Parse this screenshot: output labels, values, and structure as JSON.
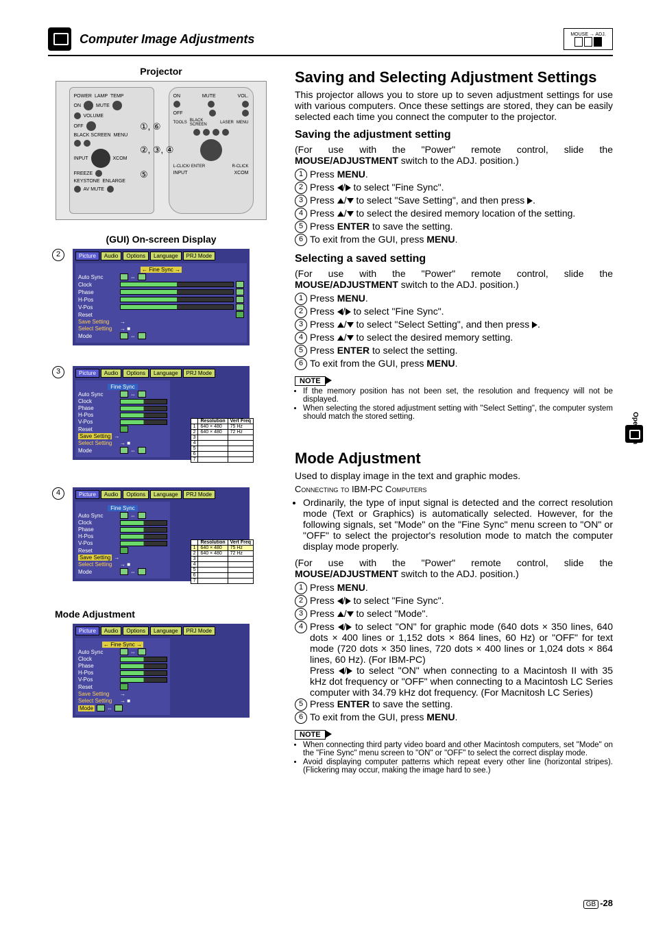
{
  "header": {
    "title": "Computer Image Adjustments",
    "switch_top": "MOUSE",
    "switch_right": "ADJ."
  },
  "left": {
    "projector_label": "Projector",
    "callouts": {
      "a": "①, ⑥",
      "b": "②, ③, ④",
      "c": "⑤"
    },
    "remote": {
      "on_lbl": "ON",
      "mute_lbl": "MUTE",
      "off_lbl": "OFF",
      "black_lbl": "BLACK SCREEN",
      "menu_lbl": "MENU",
      "input_lbl": "INPUT",
      "freeze_lbl": "FREEZE",
      "keystone_lbl": "KEYSTONE",
      "av_lbl": "AV MUTE",
      "vol_lbl": "VOL.",
      "laser_lbl": "LASER",
      "tools_lbl": "TOOLS",
      "enlarge_lbl": "ENLARGE",
      "rc_lbl": "R-CLICK",
      "enter_lbl": "L-CLICK/ ENTER",
      "xcom_lbl": "XCOM"
    },
    "gui_label": "(GUI) On-screen Display",
    "osd_common": {
      "tabs": [
        "Picture",
        "Audio",
        "Options",
        "Language",
        "PRJ Mode"
      ],
      "fine_sync": "Fine Sync",
      "rows": [
        "Auto Sync",
        "Clock",
        "Phase",
        "H-Pos",
        "V-Pos",
        "Reset"
      ],
      "save": "Save Setting",
      "select": "Select Setting",
      "mode": "Mode"
    },
    "subtable": {
      "h1": "Resolution",
      "h2": "Vert Freq",
      "r1c1": "640 × 480",
      "r1c2": "75 Hz",
      "r2c1": "640 × 480",
      "r2c2": "72 Hz"
    },
    "mode_adj_label": "Mode Adjustment"
  },
  "right": {
    "sec1_title": "Saving and Selecting Adjustment Settings",
    "sec1_intro": "This projector allows you to store up to seven adjustment settings for use with various computers. Once these settings are stored, they can be easily selected each time you connect the computer to the projector.",
    "save_sub": "Saving the adjustment setting",
    "slide_note": "(For use with the \"Power\" remote control, slide the ",
    "slide_bold": "MOUSE/ADJUSTMENT",
    "slide_rest": " switch to the ADJ. position.)",
    "save_steps": [
      "Press MENU.",
      "Press ◀/▶ to select \"Fine Sync\".",
      "Press ▲/▼ to select \"Save Setting\", and then press ▶.",
      "Press ▲/▼ to select the desired memory location of the setting.",
      "Press ENTER to save the setting.",
      "To exit from the GUI, press MENU."
    ],
    "select_sub": "Selecting a saved setting",
    "select_steps": [
      "Press MENU.",
      "Press ◀/▶ to select \"Fine Sync\".",
      "Press ▲/▼ to select \"Select Setting\", and then press ▶.",
      "Press ▲/▼ to select the desired memory setting.",
      "Press ENTER to select the setting.",
      "To exit from the GUI, press MENU."
    ],
    "note_label": "NOTE",
    "notes1": [
      "If the memory position has not been set, the resolution and frequency will not be displayed.",
      "When selecting the stored adjustment setting with \"Select Setting\", the computer system should match the stored setting."
    ],
    "sec2_title": "Mode Adjustment",
    "sec2_intro": "Used to display image in the text and graphic modes.",
    "sec2_sc": "Connecting to IBM-PC Computers",
    "sec2_bullet": "Ordinarily, the type of input signal is detected and the correct resolution mode (Text or Graphics) is automatically selected. However, for the following signals, set \"Mode\" on the \"Fine Sync\" menu screen to \"ON\" or \"OFF\" to select the projector's resolution mode to match the computer display mode properly.",
    "mode_steps": [
      "Press MENU.",
      "Press ◀/▶ to select \"Fine Sync\".",
      "Press ▲/▼ to select \"Mode\".",
      "Press ◀/▶ to select \"ON\" for graphic mode (640 dots × 350 lines, 640 dots × 400 lines or 1,152 dots × 864 lines, 60 Hz) or \"OFF\" for text mode (720 dots × 350 lines, 720 dots × 400 lines or 1,024 dots × 864 lines, 60 Hz). (For IBM-PC)\nPress ◀/▶ to select \"ON\" when connecting to a Macintosh II with 35 kHz dot frequency or \"OFF\" when connecting to a Macintosh LC Series computer with 34.79 kHz dot frequency. (For Macnitosh LC Series)",
      "Press ENTER to save the setting.",
      "To exit from the GUI, press MENU."
    ],
    "notes2": [
      "When connecting third party video board and other Macintosh computers, set \"Mode\" on the \"Fine Sync\" menu screen to \"ON\" or \"OFF\" to select the correct display mode.",
      "Avoid displaying computer patterns which repeat every other line (horizontal stripes). (Flickering may occur, making the image hard to see.)"
    ]
  },
  "side_label": "Operation",
  "page_num": "-28",
  "gb": "GB"
}
